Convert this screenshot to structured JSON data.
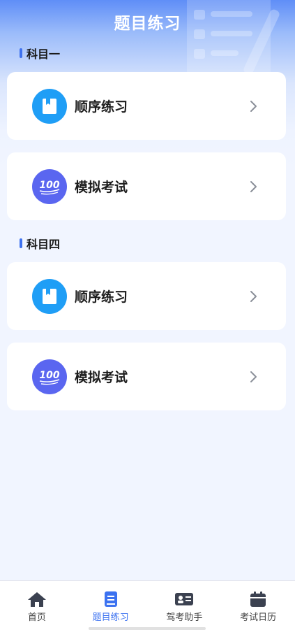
{
  "header": {
    "title": "题目练习"
  },
  "sections": [
    {
      "title": "科目一",
      "cards": [
        {
          "label": "顺序练习",
          "icon": "book-icon"
        },
        {
          "label": "模拟考试",
          "icon": "score-100-icon"
        }
      ]
    },
    {
      "title": "科目四",
      "cards": [
        {
          "label": "顺序练习",
          "icon": "book-icon"
        },
        {
          "label": "模拟考试",
          "icon": "score-100-icon"
        }
      ]
    }
  ],
  "score_icon_text": "100",
  "tabbar": {
    "active_index": 1,
    "items": [
      {
        "label": "首页",
        "icon": "home-icon"
      },
      {
        "label": "题目练习",
        "icon": "exercise-book-icon"
      },
      {
        "label": "驾考助手",
        "icon": "id-card-icon"
      },
      {
        "label": "考试日历",
        "icon": "calendar-icon"
      }
    ]
  },
  "colors": {
    "accent": "#3c72f0",
    "book_icon_bg": "#1f9ef6",
    "score_icon_bg": "#5a66f0"
  }
}
